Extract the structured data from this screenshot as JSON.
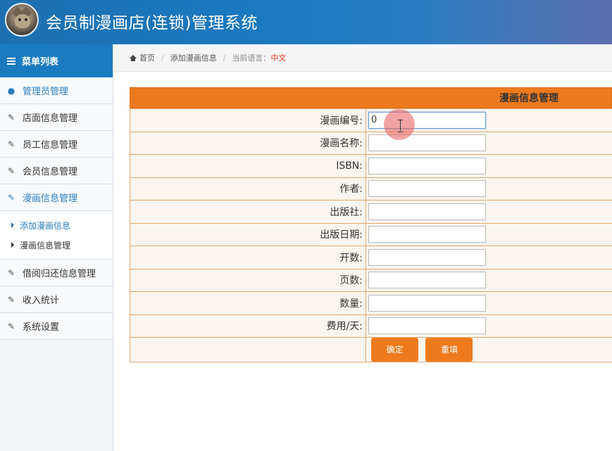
{
  "header": {
    "title": "会员制漫画店(连锁)管理系统",
    "avatar_icon": "cat-avatar"
  },
  "sidebar": {
    "menu_title": "菜单列表",
    "items": [
      {
        "label": "管理员管理",
        "icon": "user-icon"
      },
      {
        "label": "店面信息管理",
        "icon": "edit-icon"
      },
      {
        "label": "员工信息管理",
        "icon": "edit-icon"
      },
      {
        "label": "会员信息管理",
        "icon": "edit-icon"
      },
      {
        "label": "漫画信息管理",
        "icon": "edit-icon"
      },
      {
        "label": "借阅归还信息管理",
        "icon": "edit-icon"
      },
      {
        "label": "收入统计",
        "icon": "edit-icon"
      },
      {
        "label": "系统设置",
        "icon": "edit-icon"
      }
    ],
    "subitems": [
      {
        "label": "添加漫画信息"
      },
      {
        "label": "漫画信息管理"
      }
    ]
  },
  "breadcrumb": {
    "home": "首页",
    "current": "添加漫画信息",
    "lang_label": "当前语言：",
    "lang_value": "中文"
  },
  "form": {
    "title": "漫画信息管理",
    "fields": [
      {
        "label": "漫画编号:",
        "value": "0"
      },
      {
        "label": "漫画名称:",
        "value": ""
      },
      {
        "label": "ISBN:",
        "value": ""
      },
      {
        "label": "作者:",
        "value": ""
      },
      {
        "label": "出版社:",
        "value": ""
      },
      {
        "label": "出版日期:",
        "value": ""
      },
      {
        "label": "开数:",
        "value": ""
      },
      {
        "label": "页数:",
        "value": ""
      },
      {
        "label": "数量:",
        "value": ""
      },
      {
        "label": "费用/天:",
        "value": ""
      }
    ],
    "submit_label": "确定",
    "reset_label": "重填"
  },
  "colors": {
    "header_blue": "#1a7bbf",
    "accent_orange": "#ee7a1d",
    "active_blue": "#2a7fc1"
  }
}
